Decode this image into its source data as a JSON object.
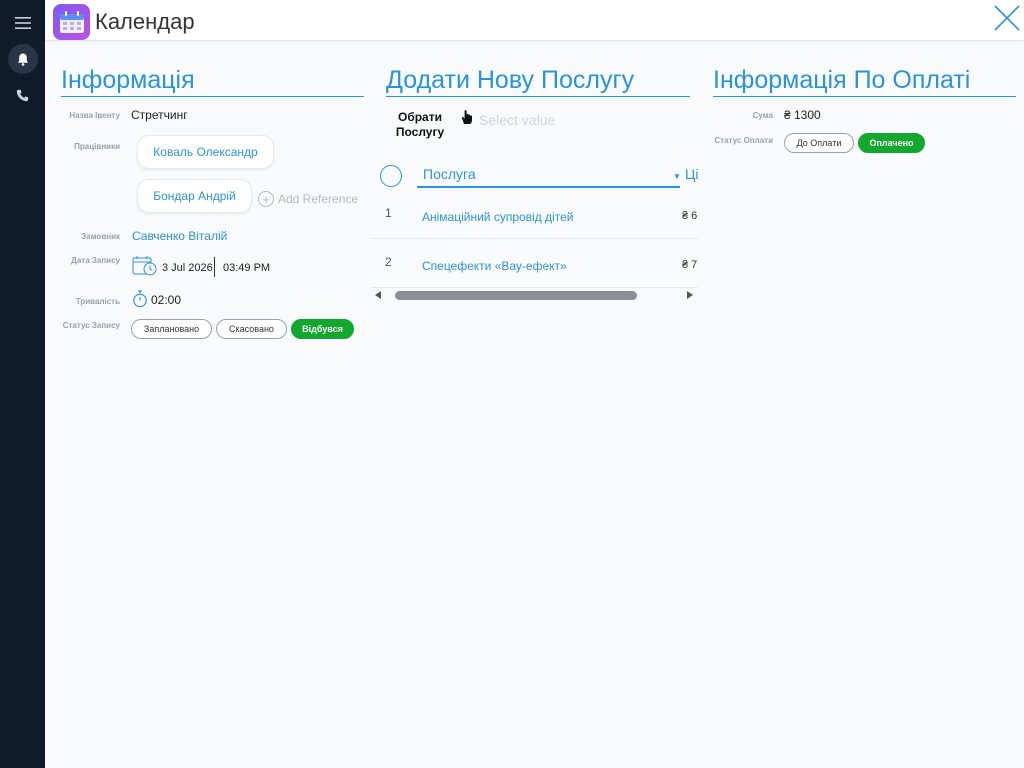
{
  "app": {
    "title": "Календар"
  },
  "info": {
    "heading": "Інформація",
    "event_label": "Назва Івенту",
    "event_value": "Стретчинг",
    "workers_label": "Працівники",
    "workers": [
      "Коваль Олександр",
      "Бондар Андрій"
    ],
    "add_reference": "Add Reference",
    "customer_label": "Замовник",
    "customer_value": "Савченко Віталій",
    "date_label": "Дата Запису",
    "date_value": "3 Jul 2026",
    "time_value": "03:49 PM",
    "duration_label": "Тривалість",
    "duration_value": "02:00",
    "status_label": "Статус Запису",
    "status_options": [
      "Заплановано",
      "Скасовано",
      "Відбувся"
    ],
    "status_selected": "Відбувся"
  },
  "services": {
    "heading": "Додати Нову Послугу",
    "pick_label": "Обрати Послугу",
    "pick_placeholder": "Select value",
    "col_service": "Послуга",
    "col_price": "Ці",
    "rows": [
      {
        "num": "1",
        "name": "Анімаційний супровід дітей",
        "price": "₴ 6"
      },
      {
        "num": "2",
        "name": "Спецефекти «Вау-ефект»",
        "price": "₴ 7"
      }
    ]
  },
  "payment": {
    "heading": "Інформація По Оплаті",
    "sum_label": "Сума",
    "sum_value": "₴ 1300",
    "status_label": "Статус Оплати",
    "status_options": [
      "До Оплати",
      "Оплачено"
    ],
    "status_selected": "Оплачено"
  },
  "colors": {
    "accent": "#2b93dc",
    "success": "#11a82d",
    "rail": "#0f1a2b"
  }
}
